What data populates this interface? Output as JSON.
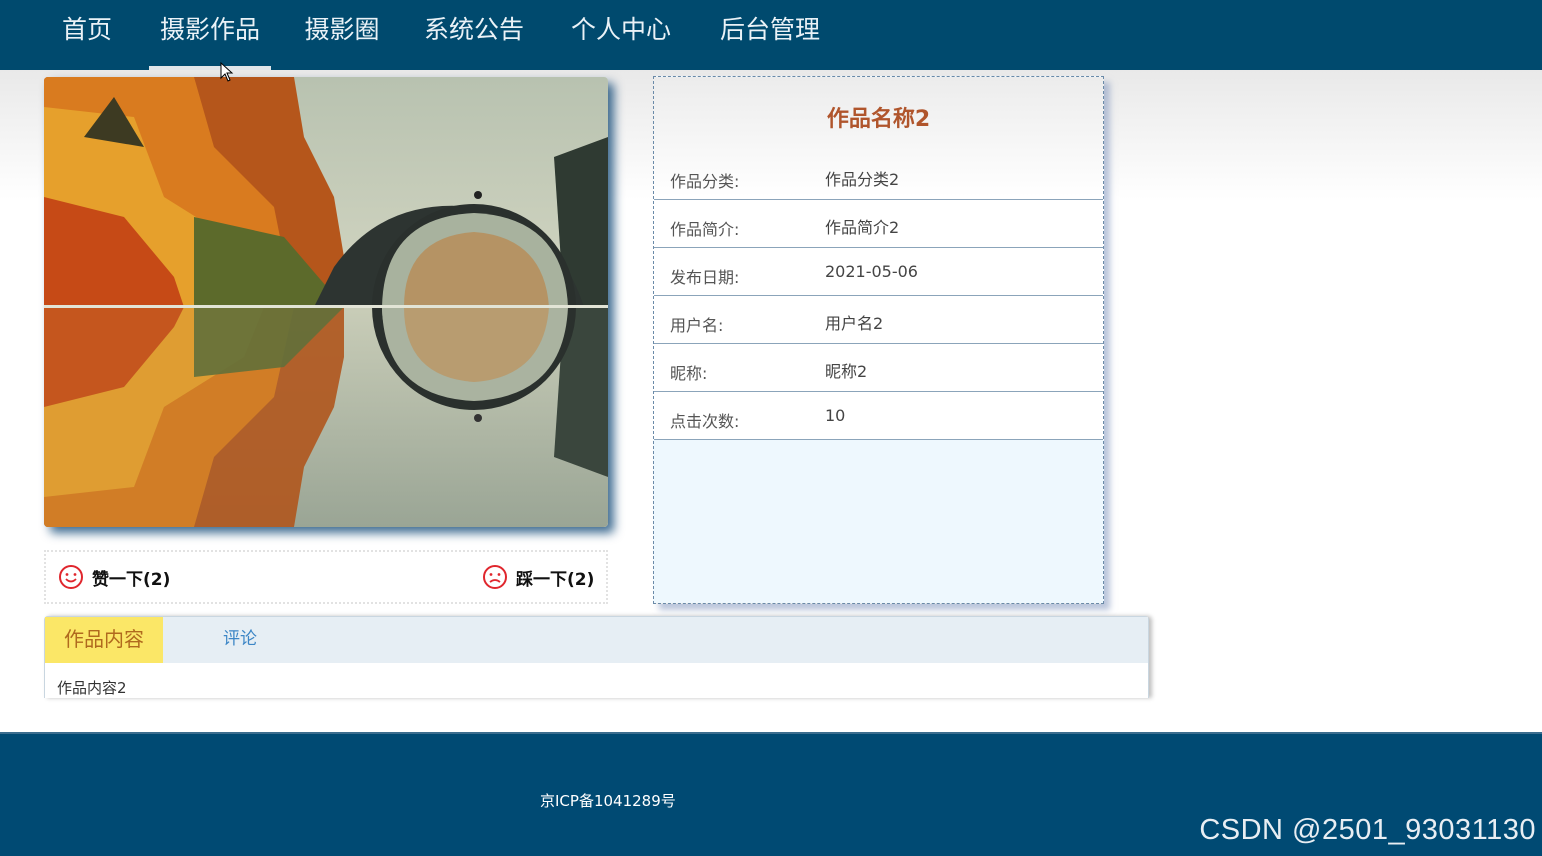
{
  "nav": {
    "items": [
      {
        "label": "首页"
      },
      {
        "label": "摄影作品"
      },
      {
        "label": "摄影圈"
      },
      {
        "label": "系统公告"
      },
      {
        "label": "个人中心"
      },
      {
        "label": "后台管理"
      }
    ],
    "active_index": 1
  },
  "votes": {
    "like_label": "赞一下(2)",
    "dislike_label": "踩一下(2)"
  },
  "work": {
    "title": "作品名称2",
    "fields": [
      {
        "label": "作品分类:",
        "value": "作品分类2"
      },
      {
        "label": "作品简介:",
        "value": "作品简介2"
      },
      {
        "label": "发布日期:",
        "value": "2021-05-06"
      },
      {
        "label": "用户名:",
        "value": "用户名2"
      },
      {
        "label": "昵称:",
        "value": "昵称2"
      },
      {
        "label": "点击次数:",
        "value": "10"
      }
    ]
  },
  "tabs": {
    "items": [
      {
        "label": "作品内容"
      },
      {
        "label": "评论"
      }
    ],
    "content": "作品内容2"
  },
  "footer": {
    "icp": "京ICP备1041289号"
  },
  "watermark": "CSDN @2501_93031130",
  "colors": {
    "nav_bg": "#004a6e",
    "title_accent": "#b0552c",
    "active_tab": "#fbe767",
    "vote_icon": "#e0262d"
  }
}
